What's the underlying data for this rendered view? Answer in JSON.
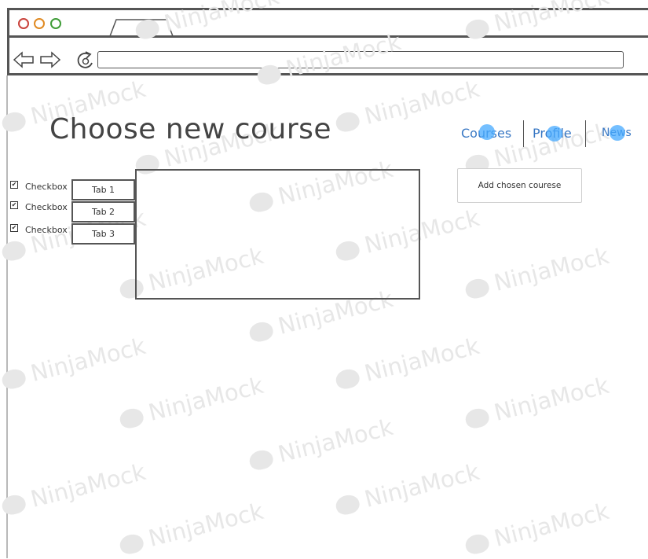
{
  "watermark": {
    "text": "NinjaMock"
  },
  "page": {
    "title": "Choose new course"
  },
  "nav": {
    "courses": "Courses",
    "profile": "Profile",
    "news": "News"
  },
  "actions": {
    "add_label": "Add chosen courese"
  },
  "checkboxes": [
    {
      "label": "Checkbox",
      "checked": true
    },
    {
      "label": "Checkbox",
      "checked": true
    },
    {
      "label": "Checkbox",
      "checked": true
    }
  ],
  "tabs": [
    {
      "label": "Tab 1"
    },
    {
      "label": "Tab 2"
    },
    {
      "label": "Tab 3"
    }
  ],
  "colors": {
    "link": "#3978c4",
    "click_marker": "#46aaff",
    "border": "#555555",
    "traffic_red": "#c9423b",
    "traffic_orange": "#e08a22",
    "traffic_green": "#3f9c37"
  }
}
